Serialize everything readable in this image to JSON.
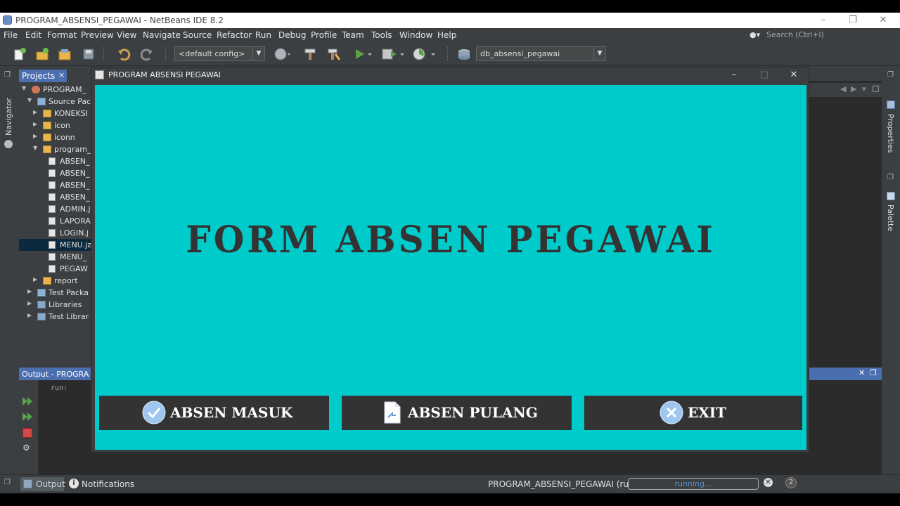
{
  "ide": {
    "window_title": "PROGRAM_ABSENSI_PEGAWAI - NetBeans IDE 8.2",
    "menu": [
      "File",
      "Edit",
      "Format",
      "Preview",
      "View",
      "Navigate",
      "Source",
      "Refactor",
      "Run",
      "Debug",
      "Profile",
      "Team",
      "Tools",
      "Window",
      "Help"
    ],
    "search_placeholder": "Search (Ctrl+I)",
    "config_combo": "<default config>",
    "db_combo": "db_absensi_pegawai"
  },
  "left_strip": {
    "navigator_label": "Navigator"
  },
  "projects": {
    "tab_label": "Projects",
    "tree": [
      {
        "label": "PROGRAM_",
        "icon": "project-icon",
        "depth": 0,
        "expanded": true
      },
      {
        "label": "Source Pac",
        "icon": "source-package-icon",
        "depth": 1,
        "expanded": true
      },
      {
        "label": "KONEKSI",
        "icon": "package-icon",
        "depth": 2,
        "expanded": false
      },
      {
        "label": "icon",
        "icon": "package-icon",
        "depth": 2,
        "expanded": false
      },
      {
        "label": "iconn",
        "icon": "package-icon",
        "depth": 2,
        "expanded": false
      },
      {
        "label": "program_",
        "icon": "package-icon",
        "depth": 2,
        "expanded": true
      },
      {
        "label": "ABSEN_",
        "icon": "java-file-icon",
        "depth": 3
      },
      {
        "label": "ABSEN_",
        "icon": "java-file-icon",
        "depth": 3
      },
      {
        "label": "ABSEN_",
        "icon": "java-file-icon",
        "depth": 3
      },
      {
        "label": "ABSEN_",
        "icon": "java-file-icon",
        "depth": 3
      },
      {
        "label": "ADMIN.j",
        "icon": "java-file-icon",
        "depth": 3
      },
      {
        "label": "LAPORA",
        "icon": "java-file-icon",
        "depth": 3
      },
      {
        "label": "LOGIN.j",
        "icon": "java-file-icon",
        "depth": 3
      },
      {
        "label": "MENU.ja",
        "icon": "java-file-icon",
        "depth": 3,
        "selected": true
      },
      {
        "label": "MENU_",
        "icon": "java-file-icon",
        "depth": 3
      },
      {
        "label": "PEGAW",
        "icon": "java-file-icon",
        "depth": 3
      },
      {
        "label": "report",
        "icon": "package-icon",
        "depth": 2,
        "expanded": false
      },
      {
        "label": "Test Packa",
        "icon": "test-package-icon",
        "depth": 1,
        "expanded": false
      },
      {
        "label": "Libraries",
        "icon": "library-icon",
        "depth": 1,
        "expanded": false
      },
      {
        "label": "Test Librar",
        "icon": "library-icon",
        "depth": 1,
        "expanded": false
      }
    ]
  },
  "output": {
    "tab_label": "Output - PROGRA",
    "console_text": "run:"
  },
  "right_strip": {
    "properties_label": "Properties",
    "palette_label": "Palette"
  },
  "statusbar": {
    "output_tab": "Output",
    "notifications": "Notifications",
    "run_label": "PROGRAM_ABSENSI_PEGAWAI (run)",
    "progress_text": "running...",
    "notification_count": "2"
  },
  "app": {
    "window_title": "PROGRAM ABSENSI PEGAWAI",
    "heading": "FORM ABSEN PEGAWAI",
    "background_color": "#00cbcb",
    "buttons": {
      "masuk": {
        "label": "ABSEN MASUK",
        "icon": "check-circle-icon"
      },
      "pulang": {
        "label": "ABSEN PULANG",
        "icon": "document-icon"
      },
      "exit": {
        "label": "EXIT",
        "icon": "close-circle-icon"
      }
    }
  }
}
